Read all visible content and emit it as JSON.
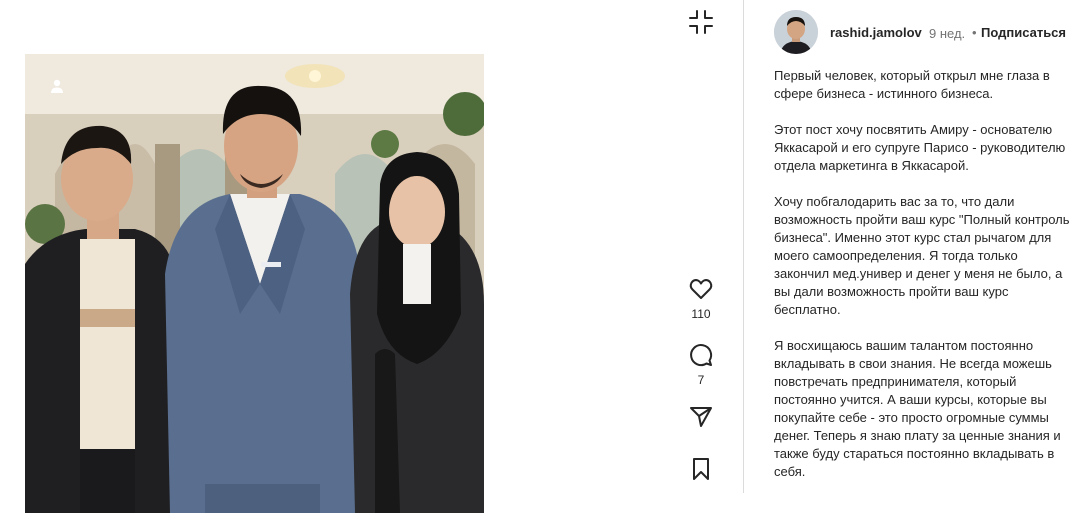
{
  "post": {
    "author": "rashid.jamolov",
    "time": "9 нед.",
    "separator": "•",
    "follow_label": "Подписаться",
    "caption_paragraphs": [
      "Первый человек, который открыл мне глаза в сфере бизнеса - истинного бизнеса.",
      "Этот пост хочу посвятить Амиру - основателю Яккасарой и его супруге Парисо - руководителю отдела маркетинга в Яккасарой.",
      "Хочу побгалодарить вас за то, что дали возможность пройти ваш курс \"Полный контроль бизнеса\". Именно этот курс стал рычагом для моего самоопределения. Я тогда только закончил мед.универ и денег у меня не было, а вы дали возможность пройти ваш курс бесплатно.",
      "Я восхищаюсь вашим талантом постоянно вкладывать в свои знания. Не всегда можешь повстречать предпринимателя, который постоянно учится. А ваши курсы, которые вы покупайте себе - это просто огромные суммы денег. Теперь я знаю плату за ценные знания и также буду стараться постоянно вкладывать в себя."
    ]
  },
  "actions": {
    "like_count": "110",
    "comment_count": "7"
  },
  "icons": {
    "collapse": "collapse-icon",
    "like": "heart-icon",
    "comment": "comment-icon",
    "share": "send-icon",
    "save": "bookmark-icon",
    "more": "more-dots-icon",
    "tag": "user-tag-icon"
  }
}
